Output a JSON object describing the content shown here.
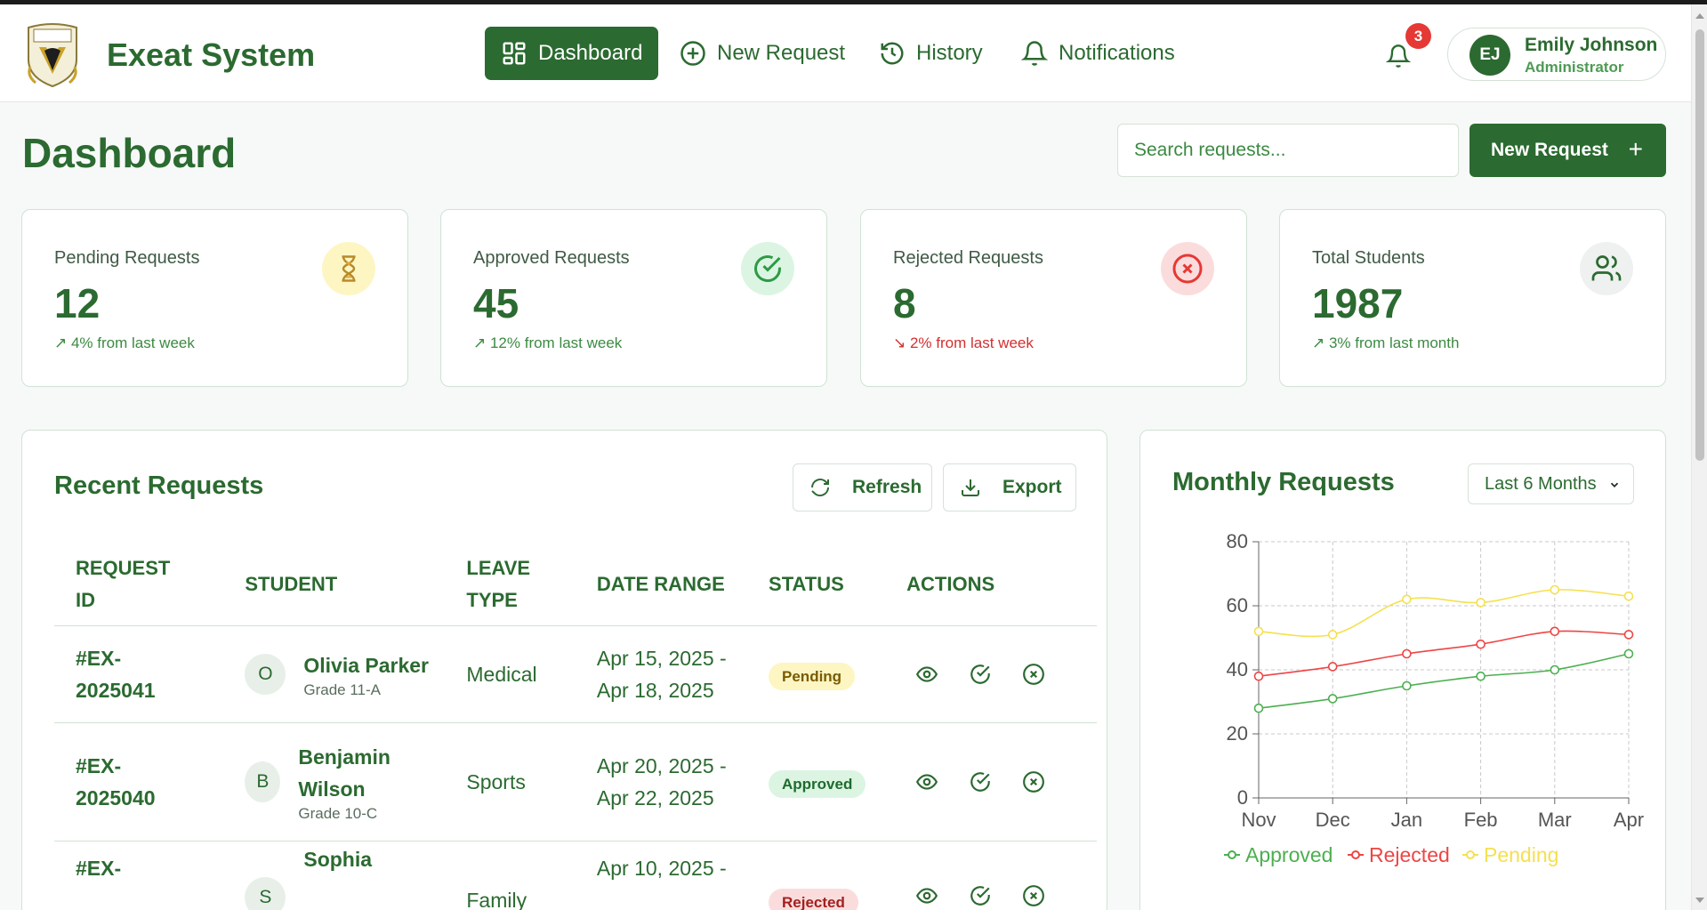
{
  "app": {
    "title": "Exeat System"
  },
  "nav": {
    "items": [
      {
        "label": "Dashboard",
        "icon": "dashboard-grid-icon",
        "active": true
      },
      {
        "label": "New Request",
        "icon": "plus-circle-icon",
        "active": false
      },
      {
        "label": "History",
        "icon": "history-icon",
        "active": false
      },
      {
        "label": "Notifications",
        "icon": "bell-icon",
        "active": false
      }
    ],
    "notification_count": "3"
  },
  "user": {
    "initials": "EJ",
    "name": "Emily Johnson",
    "role": "Administrator"
  },
  "page": {
    "title": "Dashboard",
    "search_placeholder": "Search requests...",
    "new_request_label": "New Request"
  },
  "stats": [
    {
      "label": "Pending Requests",
      "value": "12",
      "trend": "4% from last week",
      "direction": "up",
      "icon": "hourglass-icon",
      "color": "#fdf6c3"
    },
    {
      "label": "Approved Requests",
      "value": "45",
      "trend": "12% from last week",
      "direction": "up",
      "icon": "check-circle-icon",
      "color": "#dbf5e2"
    },
    {
      "label": "Rejected Requests",
      "value": "8",
      "trend": "2% from last week",
      "direction": "down",
      "icon": "x-circle-icon",
      "color": "#fbdcdc"
    },
    {
      "label": "Total Students",
      "value": "1987",
      "trend": "3% from last month",
      "direction": "up",
      "icon": "users-icon",
      "color": "#eef1ef"
    }
  ],
  "recent": {
    "title": "Recent Requests",
    "refresh_label": "Refresh",
    "export_label": "Export",
    "columns": [
      "REQUEST ID",
      "STUDENT",
      "LEAVE TYPE",
      "DATE RANGE",
      "STATUS",
      "ACTIONS"
    ],
    "rows": [
      {
        "id": "#EX-2025041",
        "initial": "O",
        "name": "Olivia Parker",
        "grade": "Grade 11-A",
        "type": "Medical",
        "range": "Apr 15, 2025 - Apr 18, 2025",
        "status": "Pending"
      },
      {
        "id": "#EX-2025040",
        "initial": "B",
        "name": "Benjamin Wilson",
        "grade": "Grade 10-C",
        "type": "Sports",
        "range": "Apr 20, 2025 - Apr 22, 2025",
        "status": "Approved"
      },
      {
        "id": "#EX-",
        "initial": "S",
        "name": "Sophia",
        "grade": "",
        "type": "Family",
        "range": "Apr 10, 2025 -",
        "status": "Rejected"
      }
    ]
  },
  "monthly": {
    "title": "Monthly Requests",
    "range_label": "Last 6 Months"
  },
  "chart_data": {
    "type": "line",
    "categories": [
      "Nov",
      "Dec",
      "Jan",
      "Feb",
      "Mar",
      "Apr"
    ],
    "ylim": [
      0,
      80
    ],
    "yticks": [
      0,
      20,
      40,
      60,
      80
    ],
    "grid": true,
    "legend": "bottom",
    "series": [
      {
        "name": "Approved",
        "color": "#4caf50",
        "values": [
          28,
          31,
          35,
          38,
          40,
          45
        ]
      },
      {
        "name": "Rejected",
        "color": "#ef4444",
        "values": [
          38,
          41,
          45,
          48,
          52,
          51
        ]
      },
      {
        "name": "Pending",
        "color": "#f5e050",
        "values": [
          52,
          51,
          62,
          61,
          65,
          63
        ]
      }
    ]
  }
}
